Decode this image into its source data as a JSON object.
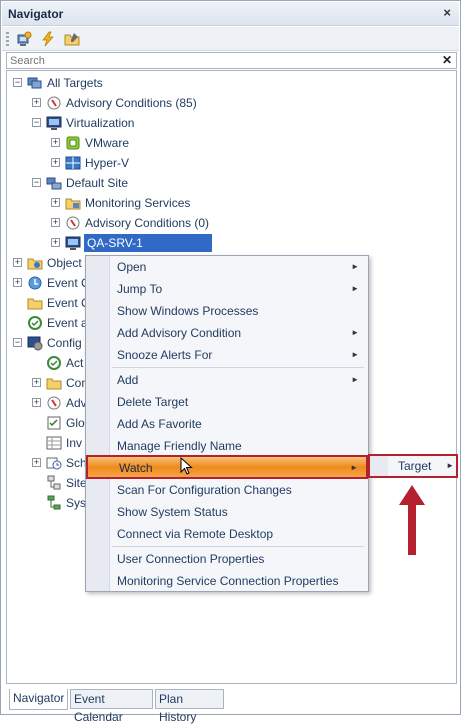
{
  "panel": {
    "title": "Navigator",
    "close_glyph": "×"
  },
  "toolbar": {
    "icons": [
      "add-targets-icon",
      "lightning-icon",
      "folder-edit-icon"
    ]
  },
  "search": {
    "placeholder": "Search",
    "value": "",
    "clear_glyph": "✕"
  },
  "tree": {
    "all_targets": "All Targets",
    "advisory_conditions_top": "Advisory Conditions (85)",
    "virtualization": "Virtualization",
    "vmware": "VMware",
    "hyperv": "Hyper-V",
    "default_site": "Default Site",
    "monitoring_services": "Monitoring Services",
    "advisory_conditions_site": "Advisory Conditions (0)",
    "qa_srv": "QA-SRV-1",
    "objects": "Object",
    "event_c1": "Event C",
    "event_c2": "Event C",
    "event_a": "Event a",
    "config": "Config",
    "act": "Act",
    "con": "Con",
    "adv": "Adv",
    "glo": "Glo",
    "inv": "Inv",
    "sch": "Sch",
    "site": "Site",
    "sys": "Sys"
  },
  "context_menu": {
    "items": [
      {
        "label": "Open",
        "submenu": true
      },
      {
        "label": "Jump To",
        "submenu": true
      },
      {
        "label": "Show Windows Processes",
        "submenu": false
      },
      {
        "label": "Add Advisory Condition",
        "submenu": true
      },
      {
        "label": "Snooze Alerts For",
        "submenu": true
      },
      {
        "label": "Add",
        "submenu": true
      },
      {
        "label": "Delete Target",
        "submenu": false
      },
      {
        "label": "Add As Favorite",
        "submenu": false
      },
      {
        "label": "Manage Friendly Name",
        "submenu": false
      },
      {
        "label": "Watch",
        "submenu": true
      },
      {
        "label": "Scan For Configuration Changes",
        "submenu": false
      },
      {
        "label": "Show System Status",
        "submenu": false
      },
      {
        "label": "Connect via Remote Desktop",
        "submenu": false
      },
      {
        "label": "User Connection Properties",
        "submenu": false
      },
      {
        "label": "Monitoring Service Connection Properties",
        "submenu": false
      }
    ],
    "highlighted": "Watch",
    "submenu_arrow": "►"
  },
  "watch_submenu": {
    "items": [
      {
        "label": "Target",
        "submenu": true
      }
    ]
  },
  "tabs": [
    {
      "label": "Navigator",
      "active": true
    },
    {
      "label": "Event Calendar",
      "active": false
    },
    {
      "label": "Plan History",
      "active": false
    }
  ],
  "colors": {
    "highlight_border": "#b5202f",
    "highlight_fill": "#f08a1c",
    "selection": "#3169c6",
    "arrow": "#b5202f"
  }
}
